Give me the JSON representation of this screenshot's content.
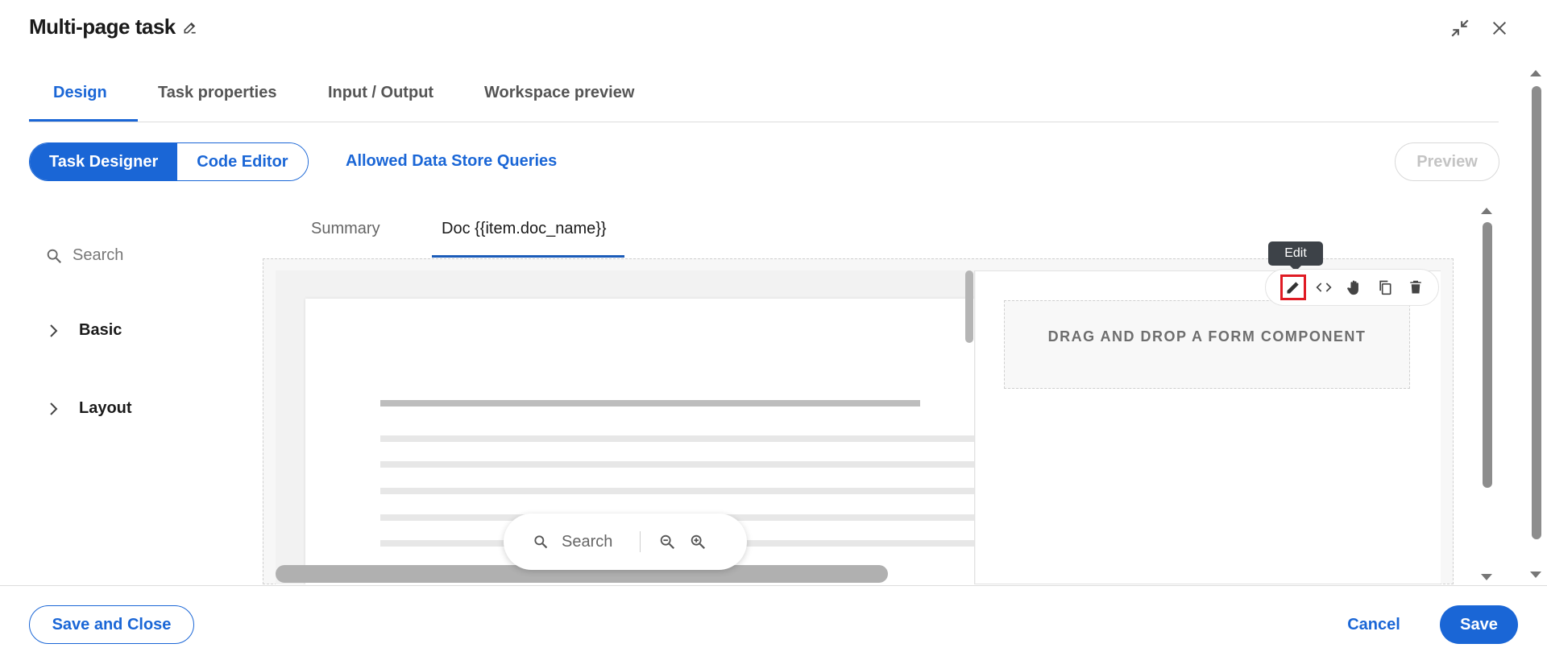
{
  "header": {
    "title": "Multi-page task",
    "title_edit_icon": "pencil-icon",
    "minimize_icon": "collapse-arrows-icon",
    "close_icon": "close-icon"
  },
  "tabs": [
    {
      "label": "Design",
      "active": true
    },
    {
      "label": "Task properties",
      "active": false
    },
    {
      "label": "Input / Output",
      "active": false
    },
    {
      "label": "Workspace preview",
      "active": false
    }
  ],
  "mode_toggle": {
    "task_designer": "Task Designer",
    "code_editor": "Code Editor",
    "selected": "Task Designer"
  },
  "allowed_queries_link": "Allowed Data Store Queries",
  "preview_button": "Preview",
  "left_panel": {
    "search_placeholder": "Search",
    "groups": [
      {
        "label": "Basic",
        "expanded": false
      },
      {
        "label": "Layout",
        "expanded": false
      }
    ]
  },
  "inner_tabs": [
    {
      "label": "Summary",
      "active": false
    },
    {
      "label": "Doc {{item.doc_name}}",
      "active": true
    }
  ],
  "doc_viewer": {
    "search_placeholder": "Search",
    "zoom_out_icon": "zoom-out-icon",
    "zoom_in_icon": "zoom-in-icon"
  },
  "form_pane": {
    "dropzone_text": "DRAG AND DROP A FORM COMPONENT"
  },
  "component_toolbar": {
    "tooltip": "Edit",
    "icons": [
      "pencil-icon",
      "code-icon",
      "hand-drag-icon",
      "copy-icon",
      "trash-icon"
    ]
  },
  "footer": {
    "save_and_close": "Save and Close",
    "cancel": "Cancel",
    "save": "Save"
  },
  "colors": {
    "accent": "#1a66d6",
    "highlight_box": "#e01b24",
    "tooltip_bg": "#3d4248"
  }
}
